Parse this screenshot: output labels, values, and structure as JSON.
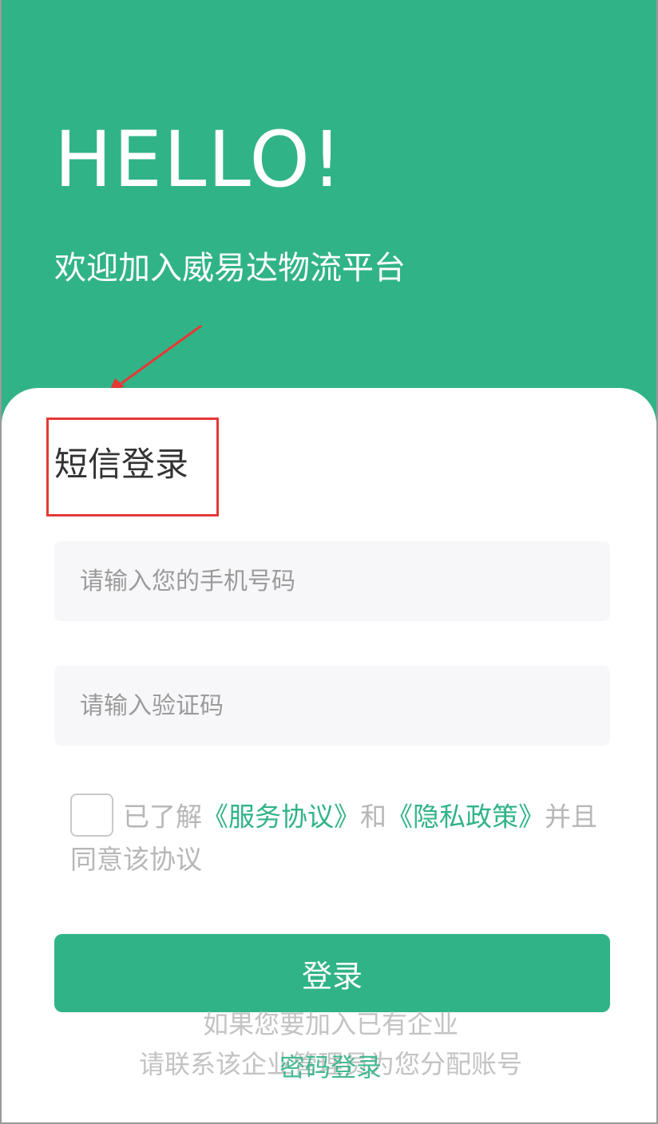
{
  "header": {
    "hello": "HELLO!",
    "welcome": "欢迎加入威易达物流平台"
  },
  "form": {
    "title": "短信登录",
    "phone_placeholder": "请输入您的手机号码",
    "code_placeholder": "请输入验证码",
    "agreement": {
      "prefix": "已了解",
      "service_link": "《服务协议》",
      "and": "和",
      "privacy_link": "《隐私政策》",
      "suffix": "并且同意该协议"
    },
    "login_button": "登录",
    "info_line1": "如果您要加入已有企业",
    "info_line2": "请联系该企业管理员为您分配账号",
    "password_login": "密码登录"
  },
  "colors": {
    "brand": "#31b388",
    "annotation": "#e53935"
  }
}
